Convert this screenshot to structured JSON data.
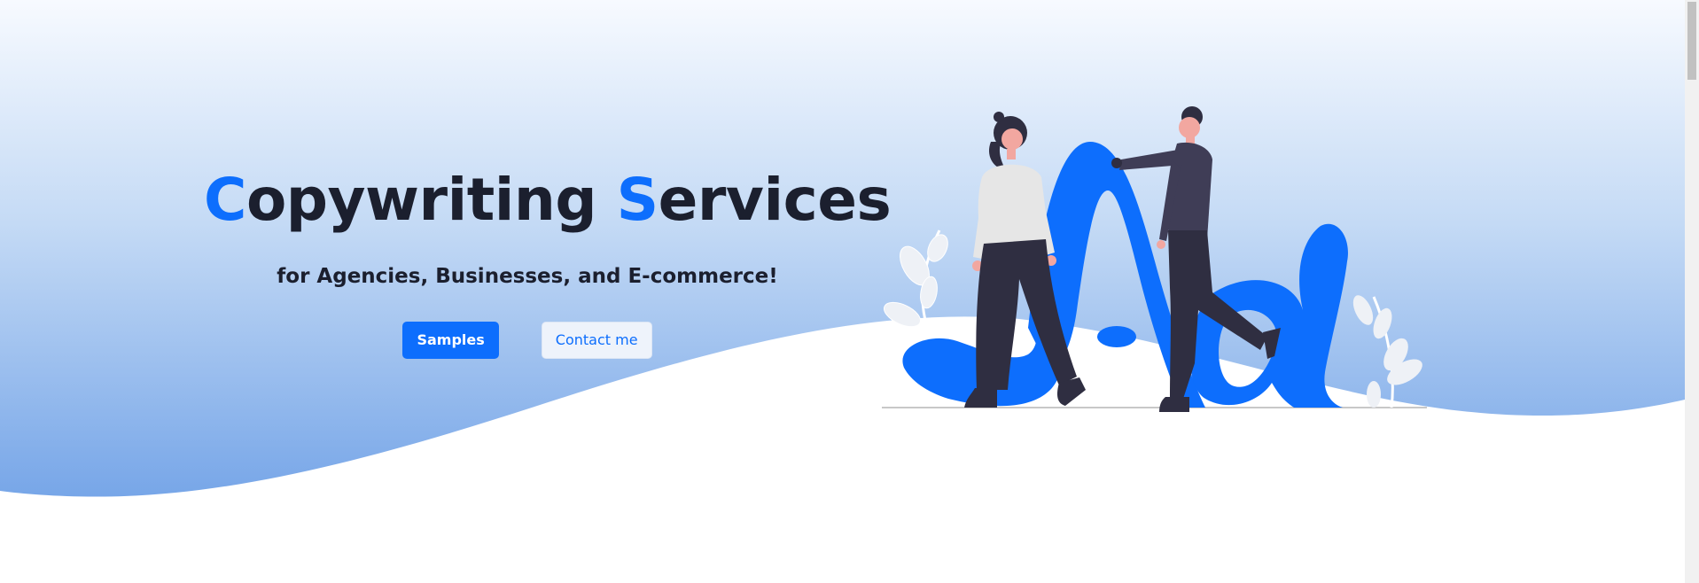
{
  "hero": {
    "title_accent_1": "C",
    "title_rest_1": "opywriting ",
    "title_accent_2": "S",
    "title_rest_2": "ervices",
    "subtitle": "for Agencies, Businesses, and E-commerce!",
    "samples_label": "Samples",
    "contact_label": "Contact me"
  },
  "colors": {
    "accent": "#0d6efd",
    "heading": "#1b1f2e",
    "gradient_top": "#f7faff",
    "gradient_bottom": "#7aa9e8",
    "figure_dark": "#3f3d56",
    "figure_pants": "#2f2e41",
    "figure_shirt": "#e6e6e6"
  },
  "illustration": {
    "icon": "people-with-letter-illustration"
  }
}
